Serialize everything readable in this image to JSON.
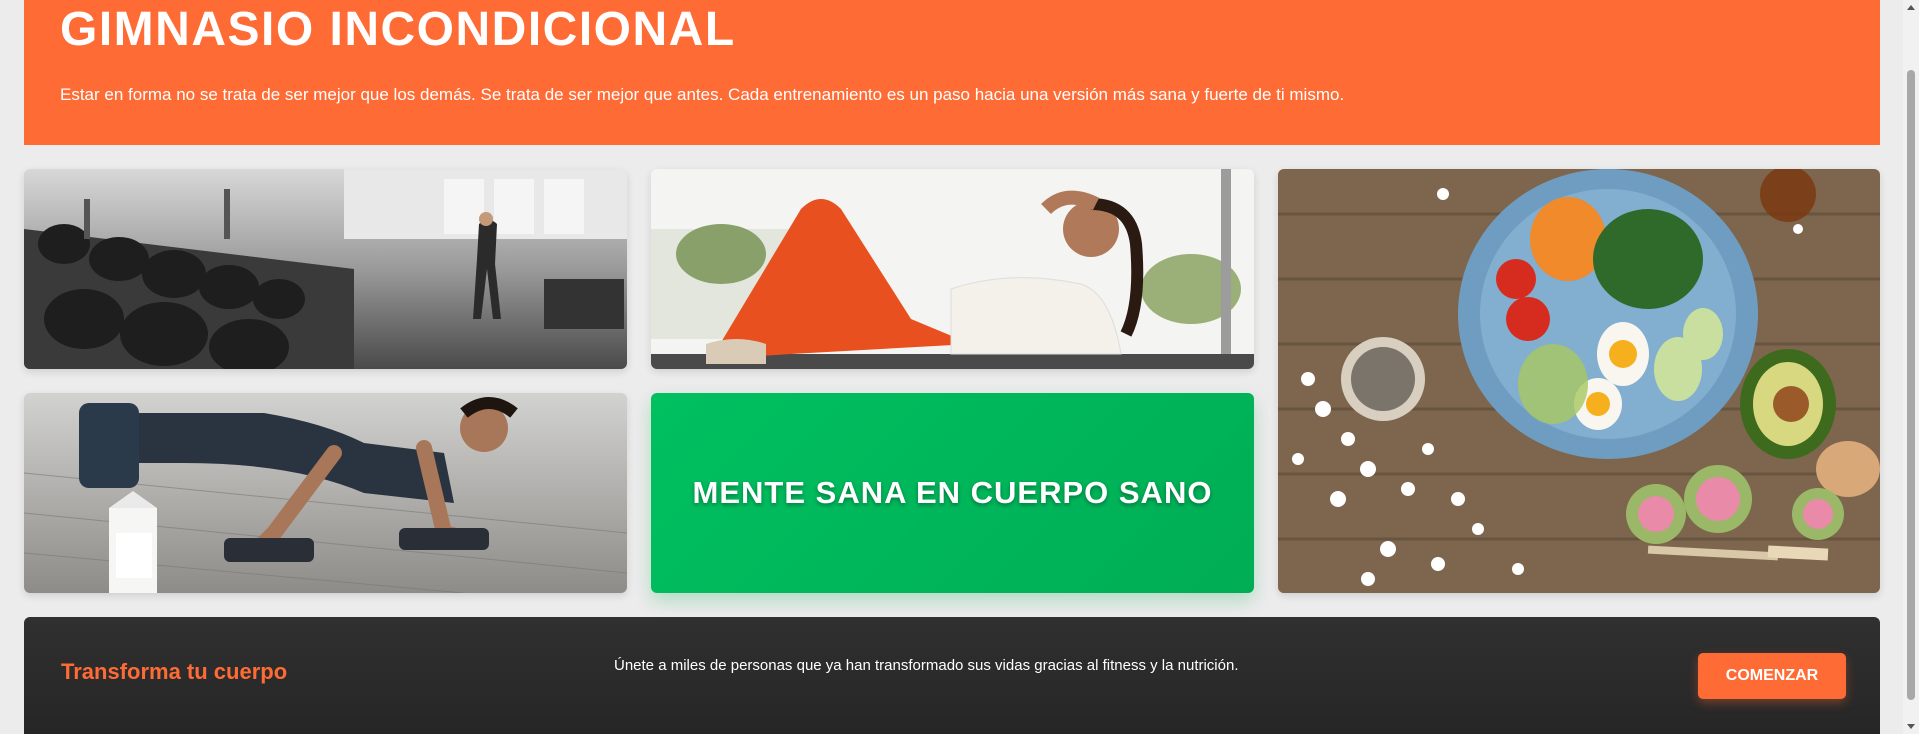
{
  "hero": {
    "title": "GIMNASIO INCONDICIONAL",
    "tagline": "Estar en forma no se trata de ser mejor que los demás. Se trata de ser mejor que antes. Cada entrenamiento es un paso hacia una versión más sana y fuerte de ti mismo."
  },
  "grid": {
    "motto": "MENTE SANA EN CUERPO SANO",
    "images": {
      "gym": "gym-dumbbell-rack",
      "abs": "woman-doing-crunches",
      "food": "healthy-food-bowl",
      "pushup": "man-pushup-dumbbells"
    }
  },
  "cta": {
    "title": "Transforma tu cuerpo",
    "description": "Únete a miles de personas que ya han transformado sus vidas gracias al fitness y la nutrición.",
    "button": "COMENZAR"
  },
  "colors": {
    "brand": "#ff6b35",
    "accent_green": "#00c060",
    "footer_bg": "#2b2b2b"
  }
}
